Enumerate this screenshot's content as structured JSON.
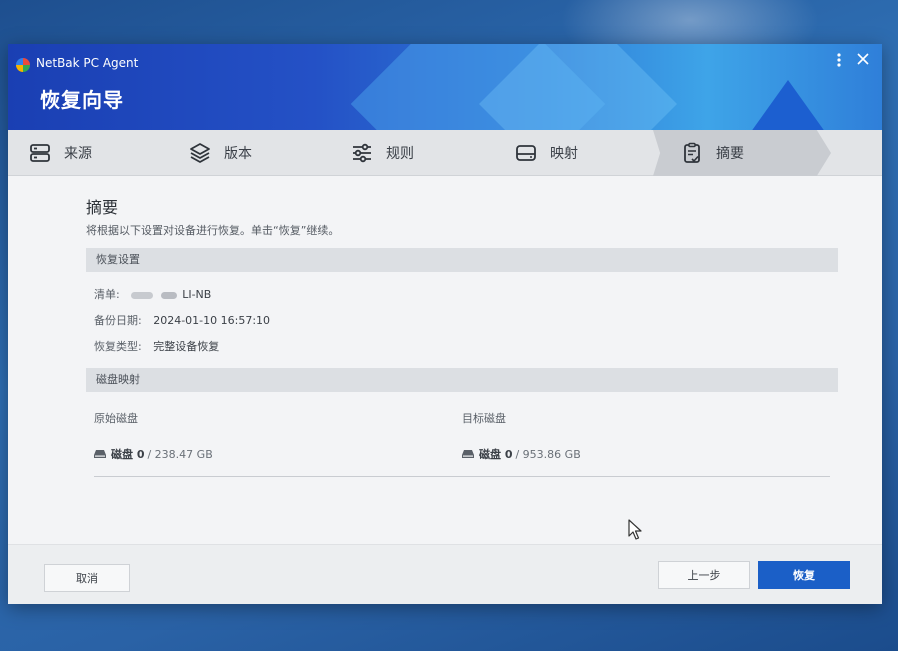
{
  "window": {
    "app_name": "NetBak PC Agent",
    "title": "恢复向导",
    "menu_icon": "kebab-menu-icon",
    "close_icon": "close-icon"
  },
  "steps": [
    {
      "label": "来源",
      "icon": "server-icon"
    },
    {
      "label": "版本",
      "icon": "layers-icon"
    },
    {
      "label": "规则",
      "icon": "sliders-icon"
    },
    {
      "label": "映射",
      "icon": "drive-icon"
    },
    {
      "label": "摘要",
      "icon": "clipboard-check-icon",
      "active": true
    }
  ],
  "summary": {
    "title": "摘要",
    "description": "将根据以下设置对设备进行恢复。单击“恢复”继续。",
    "restore_settings": {
      "header": "恢复设置",
      "list_label": "清单:",
      "list_value": "LI-NB",
      "date_label": "备份日期:",
      "date_value": "2024-01-10 16:57:10",
      "type_label": "恢复类型:",
      "type_value": "完整设备恢复"
    },
    "disk_mapping": {
      "header": "磁盘映射",
      "source_head": "原始磁盘",
      "target_head": "目标磁盘",
      "source_disk": {
        "name": "磁盘 0",
        "size": "/ 238.47 GB"
      },
      "target_disk": {
        "name": "磁盘 0",
        "size": "/ 953.86 GB"
      }
    }
  },
  "footer": {
    "cancel": "取消",
    "back": "上一步",
    "restore": "恢复"
  },
  "colors": {
    "primary": "#1b5fc7",
    "banner_start": "#1a3fb3",
    "banner_end": "#3ea4e8"
  }
}
